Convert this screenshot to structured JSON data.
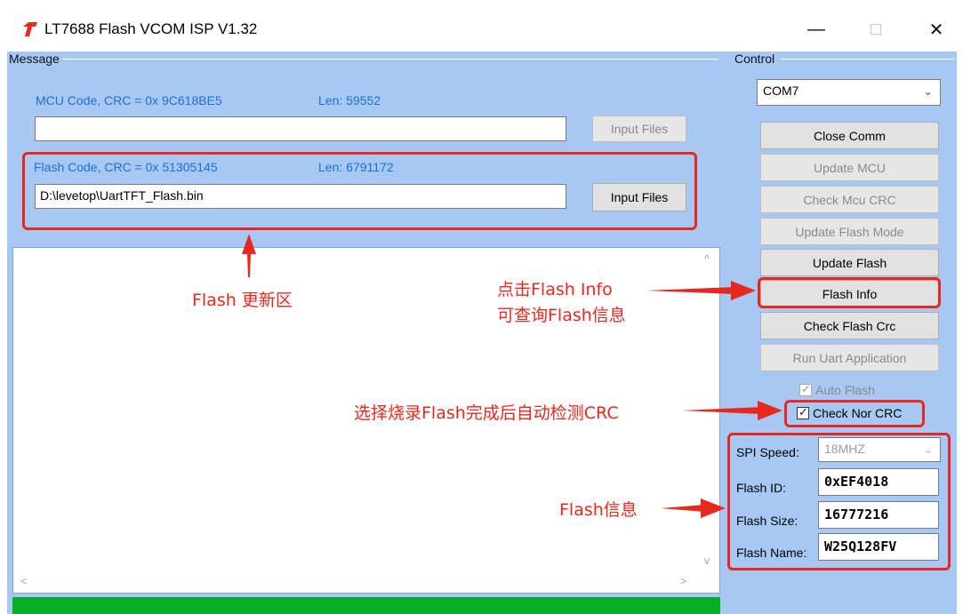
{
  "window": {
    "title": "LT7688 Flash VCOM ISP V1.32",
    "min_glyph": "—",
    "max_glyph": "□",
    "close_glyph": "✕"
  },
  "message": {
    "group_title": "Message",
    "mcu_code_label": "MCU Code, CRC = 0x 9C618BE5",
    "mcu_len_label": "Len:  59552",
    "mcu_path_value": "",
    "mcu_input_button": "Input Files",
    "flash_code_label": "Flash Code, CRC = 0x 51305145",
    "flash_len_label": "Len:  6791172",
    "flash_path_value": "D:\\levetop\\UartTFT_Flash.bin",
    "flash_input_button": "Input Files",
    "scroll_up": "^",
    "scroll_down": "v",
    "scroll_left": "<",
    "scroll_right": ">"
  },
  "control": {
    "group_title": "Control",
    "com_port": "COM7",
    "buttons": [
      {
        "label": "Close Comm",
        "enabled": true
      },
      {
        "label": "Update MCU",
        "enabled": false
      },
      {
        "label": "Check Mcu CRC",
        "enabled": false
      },
      {
        "label": "Update Flash Mode",
        "enabled": false
      },
      {
        "label": "Update Flash",
        "enabled": true
      },
      {
        "label": "Flash Info",
        "enabled": true
      },
      {
        "label": "Check Flash Crc",
        "enabled": true
      },
      {
        "label": "Run Uart Application",
        "enabled": false
      }
    ],
    "auto_flash": {
      "label": "Auto Flash",
      "checked": true,
      "enabled": false
    },
    "check_nor_crc": {
      "label": "Check Nor CRC",
      "checked": true,
      "enabled": true
    },
    "spi_speed_label": "SPI Speed:",
    "spi_speed_value": "18MHZ",
    "flash_id_label": "Flash ID:",
    "flash_id_value": "0xEF4018",
    "flash_size_label": "Flash Size:",
    "flash_size_value": "16777216",
    "flash_name_label": "Flash Name:",
    "flash_name_value": "W25Q128FV"
  },
  "annotations": {
    "flash_update_area": "Flash 更新区",
    "flash_info_line1": "点击Flash Info",
    "flash_info_line2": "可查询Flash信息",
    "auto_crc": "选择烧录Flash完成后自动检测CRC",
    "flash_info_area": "Flash信息"
  },
  "colors": {
    "client_bg": "#a6c8f2",
    "accent_blue_text": "#1e6fd6",
    "annotation_red": "#e8281e",
    "progress_green": "#06b025"
  },
  "progress_fraction": 1.0
}
